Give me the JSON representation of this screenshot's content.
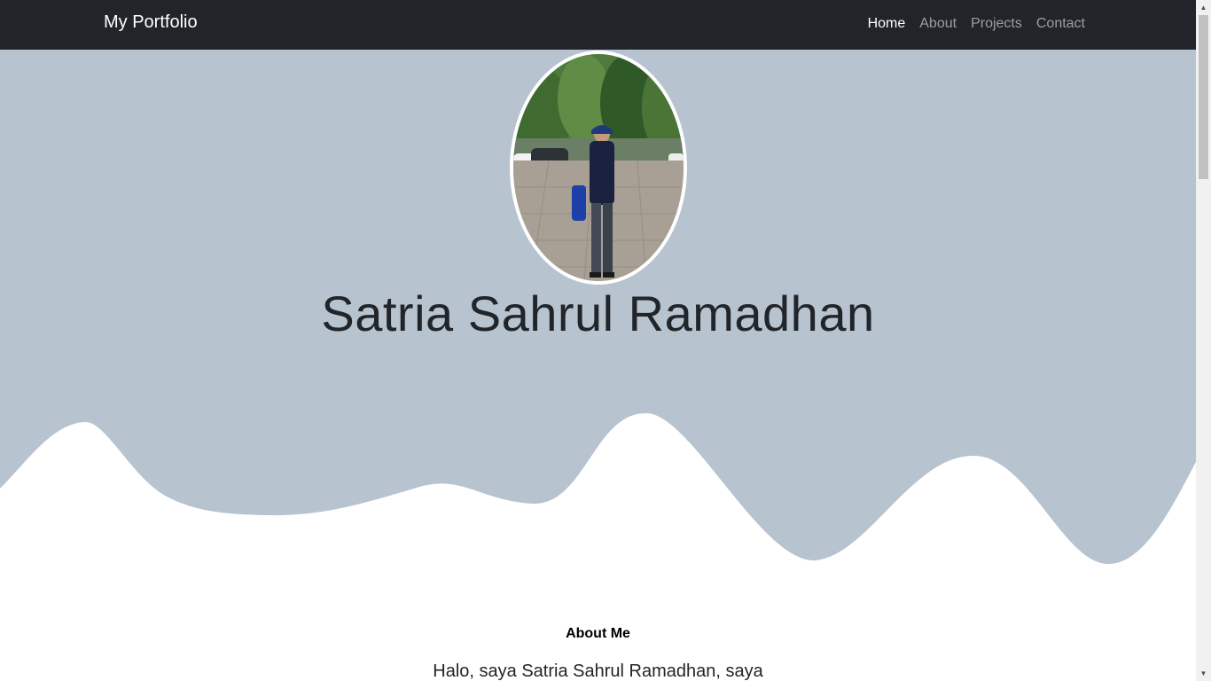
{
  "navbar": {
    "brand": "My Portfolio",
    "links": [
      {
        "label": "Home",
        "active": true
      },
      {
        "label": "About",
        "active": false
      },
      {
        "label": "Projects",
        "active": false
      },
      {
        "label": "Contact",
        "active": false
      }
    ]
  },
  "hero": {
    "name": "Satria Sahrul Ramadhan",
    "background_color": "#b7c3cf"
  },
  "about": {
    "title": "About Me",
    "text": "Halo, saya Satria Sahrul Ramadhan, saya"
  },
  "colors": {
    "navbar_bg": "#212529",
    "hero_bg": "#b7c3cf",
    "page_bg": "#ffffff"
  }
}
